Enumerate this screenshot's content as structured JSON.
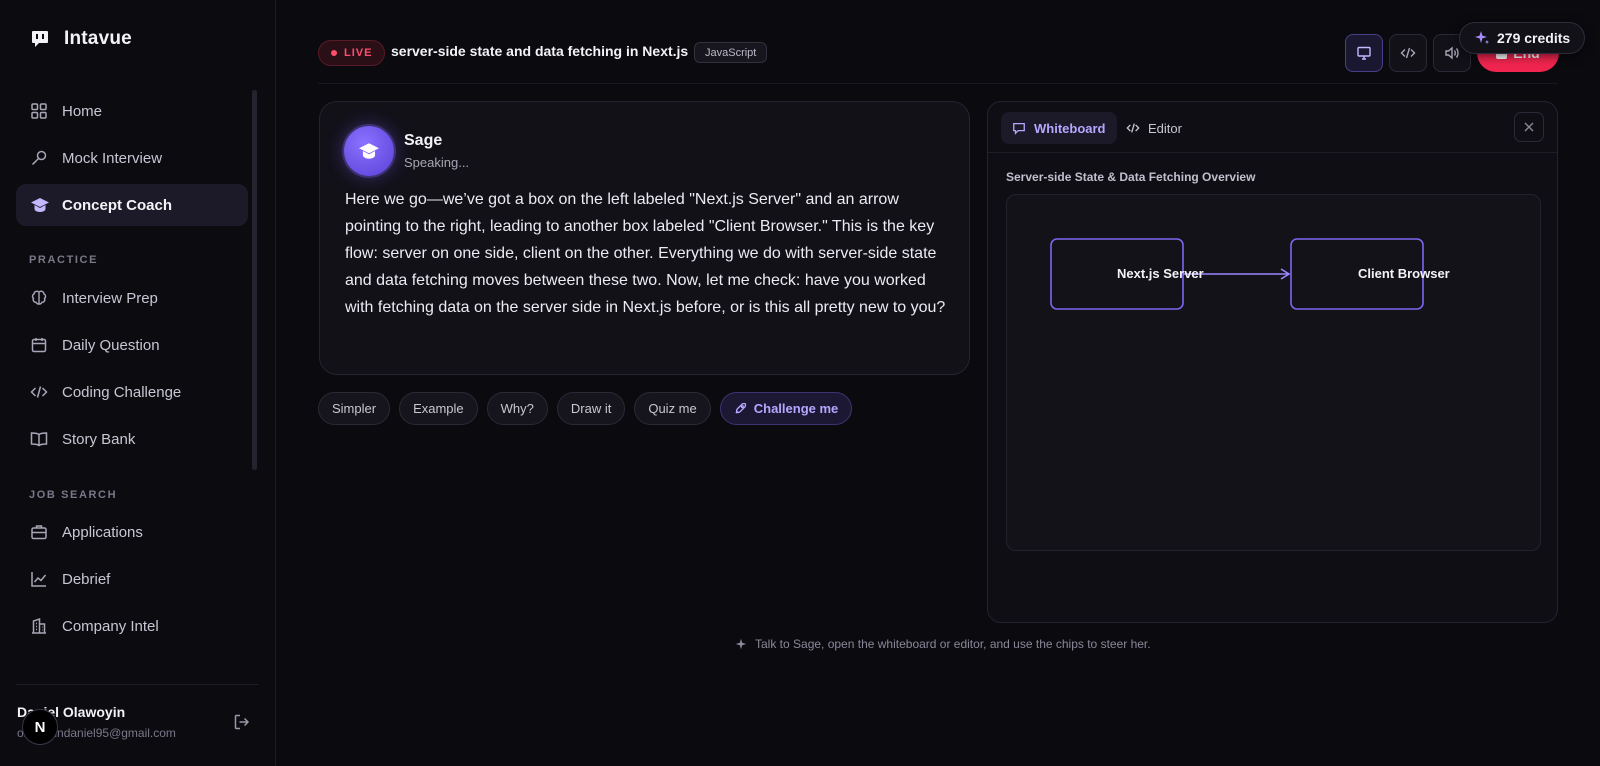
{
  "app": {
    "name": "Intavue"
  },
  "sidebar": {
    "nav_main": [
      {
        "label": "Home",
        "icon": "grid-icon"
      },
      {
        "label": "Mock Interview",
        "icon": "microphone-icon"
      },
      {
        "label": "Concept Coach",
        "icon": "graduation-cap-icon",
        "active": true
      }
    ],
    "practice_label": "PRACTICE",
    "nav_practice": [
      {
        "label": "Interview Prep",
        "icon": "brain-icon"
      },
      {
        "label": "Daily Question",
        "icon": "calendar-icon"
      },
      {
        "label": "Coding Challenge",
        "icon": "code-icon"
      },
      {
        "label": "Story Bank",
        "icon": "book-icon"
      }
    ],
    "job_search_label": "JOB SEARCH",
    "nav_job": [
      {
        "label": "Applications",
        "icon": "briefcase-icon"
      },
      {
        "label": "Debrief",
        "icon": "trend-chart-icon"
      },
      {
        "label": "Company Intel",
        "icon": "building-icon"
      }
    ],
    "user": {
      "name": "Daniel Olawoyin",
      "email": "olawoyindaniel95@gmail.com",
      "avatar_letter": "N"
    }
  },
  "header": {
    "live_label": "LIVE",
    "title": "server-side state and data fetching in Next.js",
    "language": "JavaScript",
    "credits": "279 credits",
    "end_label": "End"
  },
  "chat": {
    "assistant_name": "Sage",
    "status": "Speaking...",
    "message": "Here we go—we’ve got a box on the left labeled \"Next.js Server\" and an arrow pointing to the right, leading to another box labeled \"Client Browser.\" This is the key flow: server on one side, client on the other. Everything we do with server-side state and data fetching moves between these two. Now, let me check: have you worked with fetching data on the server side in Next.js before, or is this all pretty new to you?"
  },
  "chips": [
    {
      "label": "Simpler"
    },
    {
      "label": "Example"
    },
    {
      "label": "Why?"
    },
    {
      "label": "Draw it"
    },
    {
      "label": "Quiz me"
    },
    {
      "label": "Challenge me",
      "primary": true
    }
  ],
  "whiteboard": {
    "tabs": [
      {
        "label": "Whiteboard",
        "active": true
      },
      {
        "label": "Editor"
      }
    ],
    "title": "Server-side State & Data Fetching Overview",
    "nodes": [
      {
        "label": "Next.js Server"
      },
      {
        "label": "Client Browser"
      }
    ]
  },
  "footer_hint": "Talk to Sage, open the whiteboard or editor, and use the chips to steer her.",
  "colors": {
    "accent": "#8b72ff",
    "live": "#ff4d6d",
    "end_button": "#f0254f",
    "background": "#0b0a0f"
  }
}
